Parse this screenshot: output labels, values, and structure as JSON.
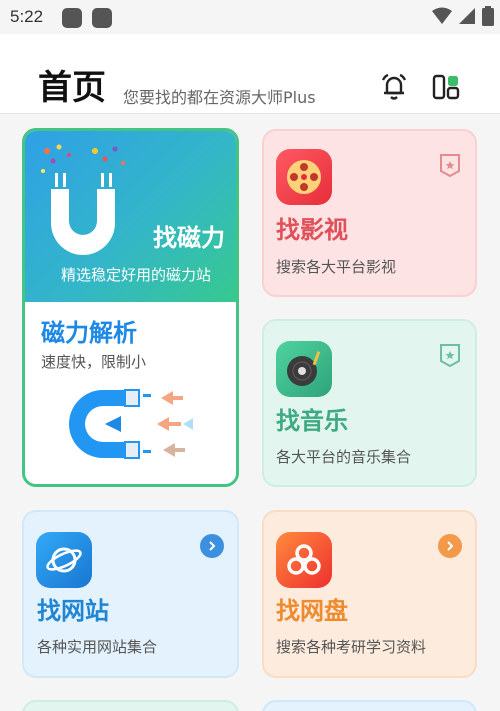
{
  "status_bar": {
    "time": "5:22",
    "icons": [
      "notification-icon",
      "notification-icon",
      "wifi-icon",
      "signal-icon",
      "battery-icon"
    ]
  },
  "header": {
    "title": "首页",
    "subtitle": "您要找的都在资源大师Plus",
    "actions": [
      "bell-icon",
      "layout-icon"
    ]
  },
  "cards": {
    "magnet": {
      "title": "找磁力",
      "desc": "精选稳定好用的磁力站",
      "parse_title": "磁力解析",
      "parse_desc": "速度快，限制小",
      "colors": {
        "gradient_from": "#2fa0e6",
        "gradient_to": "#37c98f",
        "border": "#43c483",
        "parse_title": "#1e88e5"
      }
    },
    "video": {
      "title": "找影视",
      "desc": "搜索各大平台影视",
      "badge_icon": "bookmark-star-icon",
      "colors": {
        "bg": "#fde3e3",
        "title": "#e0505a",
        "icon": "#ee3b46"
      }
    },
    "music": {
      "title": "找音乐",
      "desc": "各大平台的音乐集合",
      "badge_icon": "bookmark-star-icon",
      "colors": {
        "bg": "#e2f6ef",
        "title": "#3daa82",
        "icon": "#3dba8a"
      }
    },
    "website": {
      "title": "找网站",
      "desc": "各种实用网站集合",
      "badge_icon": "chevron-right-icon",
      "colors": {
        "bg": "#e3f2fc",
        "title": "#1f86d6",
        "icon": "#2196f3"
      }
    },
    "netdisk": {
      "title": "找网盘",
      "desc": "搜索各种考研学习资料",
      "badge_icon": "chevron-right-icon",
      "colors": {
        "bg": "#fdecdd",
        "title": "#ef8a2e",
        "icon": "#f0592a"
      }
    }
  }
}
